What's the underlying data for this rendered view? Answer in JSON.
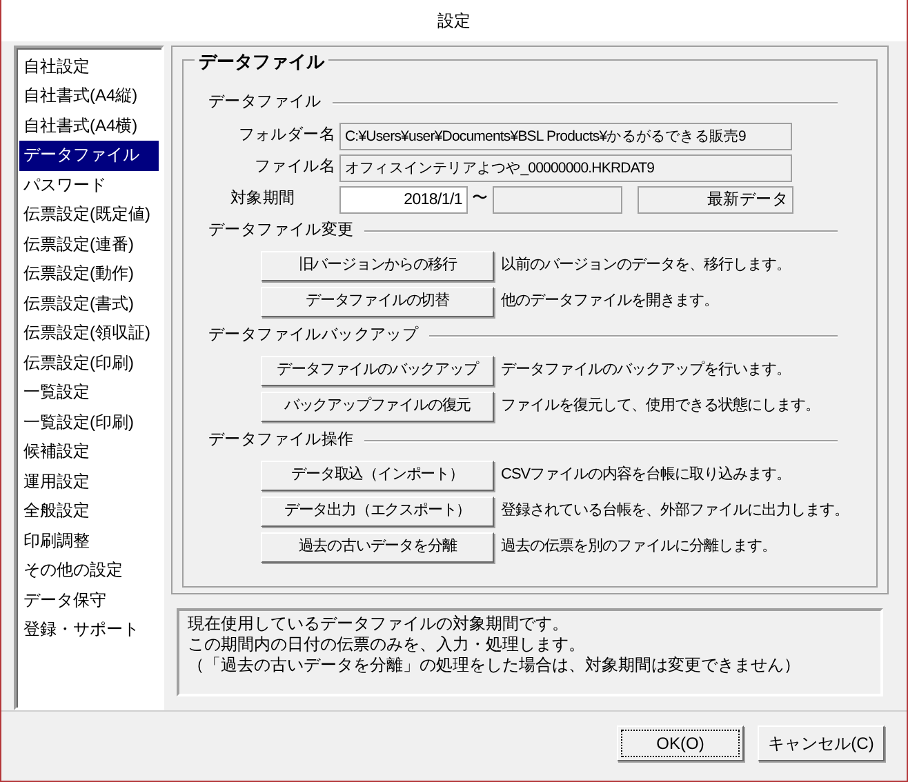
{
  "window": {
    "title": "設定"
  },
  "sidebar": {
    "items": [
      {
        "label": "自社設定",
        "selected": false
      },
      {
        "label": "自社書式(A4縦)",
        "selected": false
      },
      {
        "label": "自社書式(A4横)",
        "selected": false
      },
      {
        "label": "データファイル",
        "selected": true
      },
      {
        "label": "パスワード",
        "selected": false
      },
      {
        "label": "伝票設定(既定値)",
        "selected": false
      },
      {
        "label": "伝票設定(連番)",
        "selected": false
      },
      {
        "label": "伝票設定(動作)",
        "selected": false
      },
      {
        "label": "伝票設定(書式)",
        "selected": false
      },
      {
        "label": "伝票設定(領収証)",
        "selected": false
      },
      {
        "label": "伝票設定(印刷)",
        "selected": false
      },
      {
        "label": "一覧設定",
        "selected": false
      },
      {
        "label": "一覧設定(印刷)",
        "selected": false
      },
      {
        "label": "候補設定",
        "selected": false
      },
      {
        "label": "運用設定",
        "selected": false
      },
      {
        "label": "全般設定",
        "selected": false
      },
      {
        "label": "印刷調整",
        "selected": false
      },
      {
        "label": "その他の設定",
        "selected": false
      },
      {
        "label": "データ保守",
        "selected": false
      },
      {
        "label": "登録・サポート",
        "selected": false
      }
    ]
  },
  "panel": {
    "title": "データファイル",
    "file_section": {
      "heading": "データファイル",
      "folder": {
        "label": "フォルダー名",
        "value": "C:¥Users¥user¥Documents¥BSL Products¥かるがるできる販売9"
      },
      "file": {
        "label": "ファイル名",
        "value": "オフィスインテリアよつや_00000000.HKRDAT9"
      },
      "period": {
        "label": "対象期間",
        "start": "2018/1/1",
        "separator": "〜",
        "end_status": "最新データ"
      }
    },
    "sections": [
      {
        "heading": "データファイル変更",
        "actions": [
          {
            "button": "旧バージョンからの移行",
            "description": "以前のバージョンのデータを、移行します。"
          },
          {
            "button": "データファイルの切替",
            "description": "他のデータファイルを開きます。"
          }
        ]
      },
      {
        "heading": "データファイルバックアップ",
        "actions": [
          {
            "button": "データファイルのバックアップ",
            "description": "データファイルのバックアップを行います。"
          },
          {
            "button": "バックアップファイルの復元",
            "description": "ファイルを復元して、使用できる状態にします。"
          }
        ]
      },
      {
        "heading": "データファイル操作",
        "actions": [
          {
            "button": "データ取込（インポート）",
            "description": "CSVファイルの内容を台帳に取り込みます。"
          },
          {
            "button": "データ出力（エクスポート）",
            "description": "登録されている台帳を、外部ファイルに出力します。"
          },
          {
            "button": "過去の古いデータを分離",
            "description": "過去の伝票を別のファイルに分離します。"
          }
        ]
      }
    ]
  },
  "help_text": [
    "現在使用しているデータファイルの対象期間です。",
    "この期間内の日付の伝票のみを、入力・処理します。",
    "（「過去の古いデータを分離」の処理をした場合は、対象期間は変更できません）"
  ],
  "buttons": [
    {
      "label": "OK(O)",
      "focused": true
    },
    {
      "label": "キャンセル(C)",
      "focused": false
    }
  ]
}
